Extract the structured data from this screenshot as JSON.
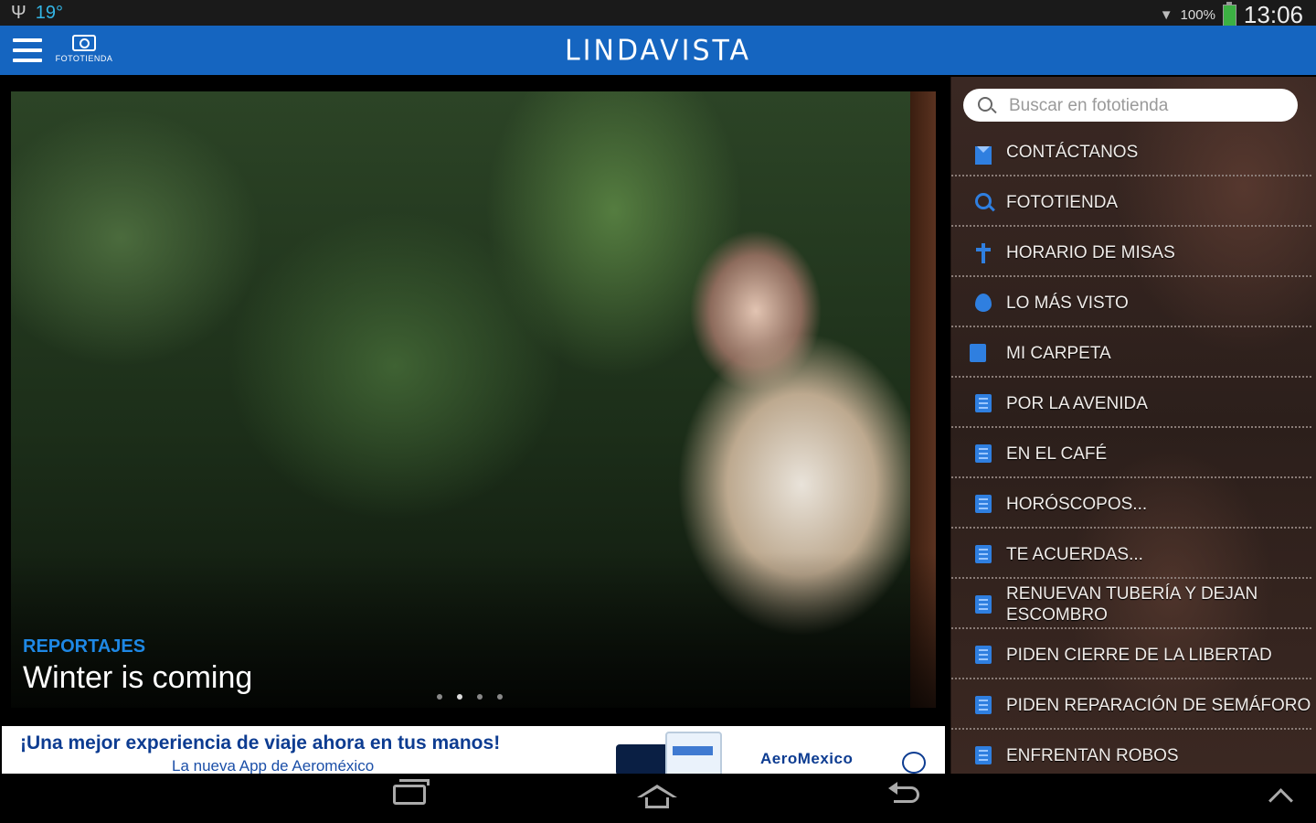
{
  "status_bar": {
    "temperature": "19°",
    "battery": "100%",
    "time": "13:06"
  },
  "app_bar": {
    "brand": "LINDAVISTA",
    "logo_text": "FOTOTIENDA"
  },
  "hero": {
    "category": "REPORTAJES",
    "title": "Winter is coming",
    "slides": 4,
    "active_slide": 2
  },
  "ad": {
    "headline": "¡Una mejor experiencia de viaje ahora en tus manos!",
    "subline": "La nueva App de Aeroméxico",
    "brand": "AeroMexico"
  },
  "sidebar": {
    "search_placeholder": "Buscar en fototienda",
    "items": [
      {
        "label": "CONTÁCTANOS",
        "icon": "mail-icon"
      },
      {
        "label": "FOTOTIENDA",
        "icon": "search-icon"
      },
      {
        "label": "HORARIO DE MISAS",
        "icon": "cross-icon"
      },
      {
        "label": "LO MÁS VISTO",
        "icon": "flame-icon"
      },
      {
        "label": "MI CARPETA",
        "icon": "folder-icon"
      },
      {
        "label": "POR LA AVENIDA",
        "icon": "document-icon"
      },
      {
        "label": "EN EL CAFÉ",
        "icon": "document-icon"
      },
      {
        "label": "HORÓSCOPOS...",
        "icon": "document-icon"
      },
      {
        "label": "TE ACUERDAS...",
        "icon": "document-icon"
      },
      {
        "label": "RENUEVAN TUBERÍA Y DEJAN ESCOMBRO",
        "icon": "document-icon"
      },
      {
        "label": "PIDEN CIERRE DE LA LIBERTAD",
        "icon": "document-icon"
      },
      {
        "label": "PIDEN REPARACIÓN DE SEMÁFORO",
        "icon": "document-icon"
      },
      {
        "label": "ENFRENTAN ROBOS",
        "icon": "document-icon"
      }
    ]
  },
  "colors": {
    "app_bar": "#1565c0",
    "accent": "#1e88e5",
    "icon_blue": "#2f7fe0",
    "sidebar_bg": "#2c1f1b"
  }
}
